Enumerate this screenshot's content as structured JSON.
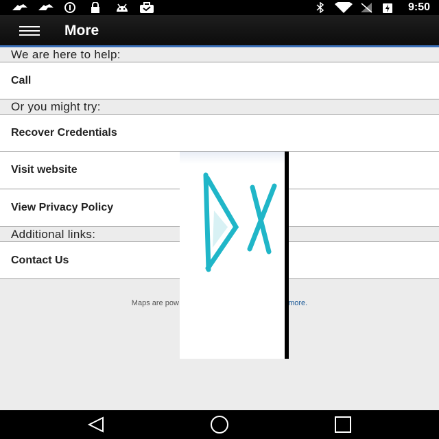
{
  "status_bar": {
    "time": "9:50",
    "icons": [
      "signal-icon",
      "signal-icon",
      "info-icon",
      "lock-icon",
      "android-icon",
      "briefcase-icon",
      "bluetooth-icon",
      "wifi-icon",
      "no-signal-icon",
      "battery-charging-icon"
    ]
  },
  "app_bar": {
    "title": "More",
    "menu_icon": "hamburger-icon",
    "accent_color": "#3a6fb8"
  },
  "sections": [
    {
      "header": "We are here to help:",
      "items": [
        "Call"
      ]
    },
    {
      "header": "Or you might try:",
      "items": [
        "Recover Credentials",
        "Visit website",
        "View Privacy Policy"
      ]
    },
    {
      "header": "Additional links:",
      "items": [
        "Contact Us"
      ]
    }
  ],
  "footer": {
    "text_start": "Maps are pow",
    "link_text": "n more.",
    "link_color": "#1f5c99"
  },
  "nav_bar": {
    "icons": [
      "back-icon",
      "home-icon",
      "recents-icon"
    ]
  }
}
